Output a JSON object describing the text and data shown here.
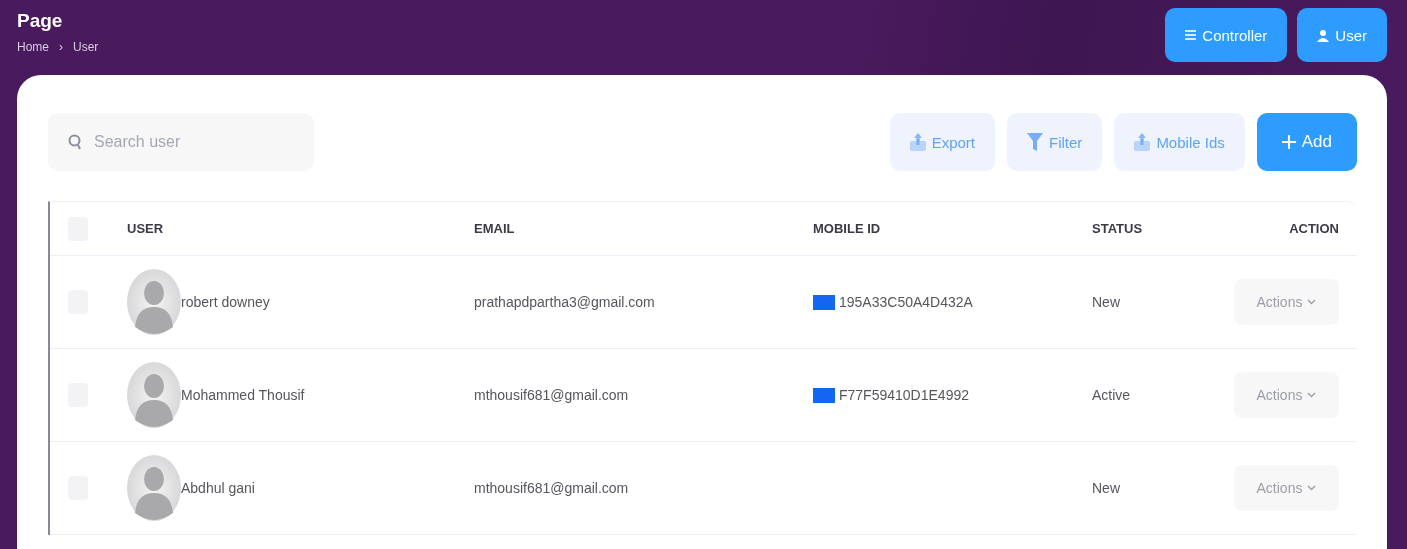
{
  "header": {
    "title": "Page",
    "breadcrumb": [
      "Home",
      "User"
    ],
    "separator": "›",
    "buttons": [
      {
        "kind": "menu",
        "label": "Controller"
      },
      {
        "kind": "user",
        "label": "User"
      }
    ]
  },
  "toolbar": {
    "search": {
      "placeholder": "Search user"
    },
    "buttons": [
      {
        "kind": "export",
        "label": "Export"
      },
      {
        "kind": "filter",
        "label": "Filter"
      },
      {
        "kind": "export",
        "label": "Mobile Ids"
      },
      {
        "kind": "add",
        "label": "Add"
      }
    ]
  },
  "table": {
    "select_all": {
      "checked": false
    },
    "columns": [
      "USER",
      "EMAIL",
      "MOBILE ID",
      "STATUS",
      "ACTION"
    ],
    "rows": [
      {
        "checked": false,
        "name": "robert downey",
        "email": "prathapdpartha3@gmail.com",
        "mobile_id": "195A33C50A4D432A",
        "status": "New",
        "action": "Actions"
      },
      {
        "checked": false,
        "name": "Mohammed Thousif",
        "email": "mthousif681@gmail.com",
        "mobile_id": "F77F59410D1E4992",
        "status": "Active",
        "action": "Actions"
      },
      {
        "checked": false,
        "name": "Abdhul gani",
        "email": "mthousif681@gmail.com",
        "status": "New",
        "action": "Actions"
      }
    ]
  }
}
